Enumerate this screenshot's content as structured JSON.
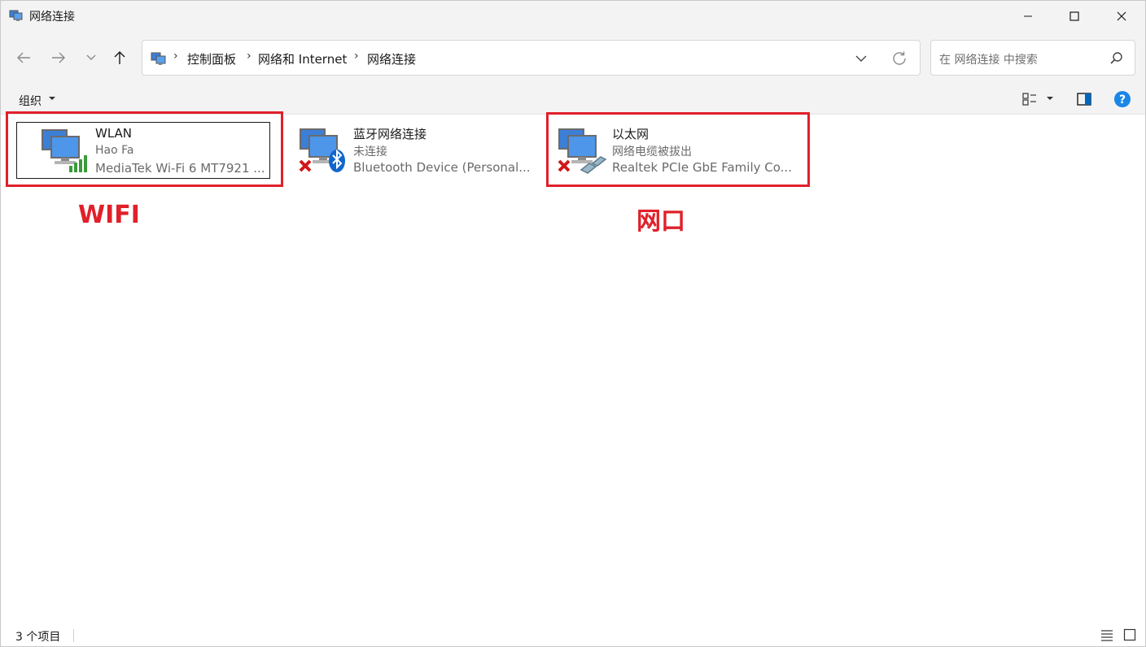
{
  "window": {
    "title": "网络连接"
  },
  "address": {
    "crumbs": [
      "控制面板",
      "网络和 Internet",
      "网络连接"
    ]
  },
  "search": {
    "placeholder": "在 网络连接 中搜索"
  },
  "toolbar": {
    "organize_label": "组织"
  },
  "items": [
    {
      "name": "WLAN",
      "status": "Hao Fa",
      "device": "MediaTek Wi-Fi 6 MT7921 ...",
      "icon": "wifi-adapter-icon"
    },
    {
      "name": "蓝牙网络连接",
      "status": "未连接",
      "device": "Bluetooth Device (Personal...",
      "icon": "bluetooth-adapter-icon"
    },
    {
      "name": "以太网",
      "status": "网络电缆被拔出",
      "device": "Realtek PCIe GbE Family Co...",
      "icon": "ethernet-adapter-icon"
    }
  ],
  "annotations": {
    "wifi": "WIFI",
    "ethernet": "网口"
  },
  "statusbar": {
    "count": "3 个项目"
  },
  "colors": {
    "annotation": "#e0202a",
    "accent": "#0067c0"
  }
}
